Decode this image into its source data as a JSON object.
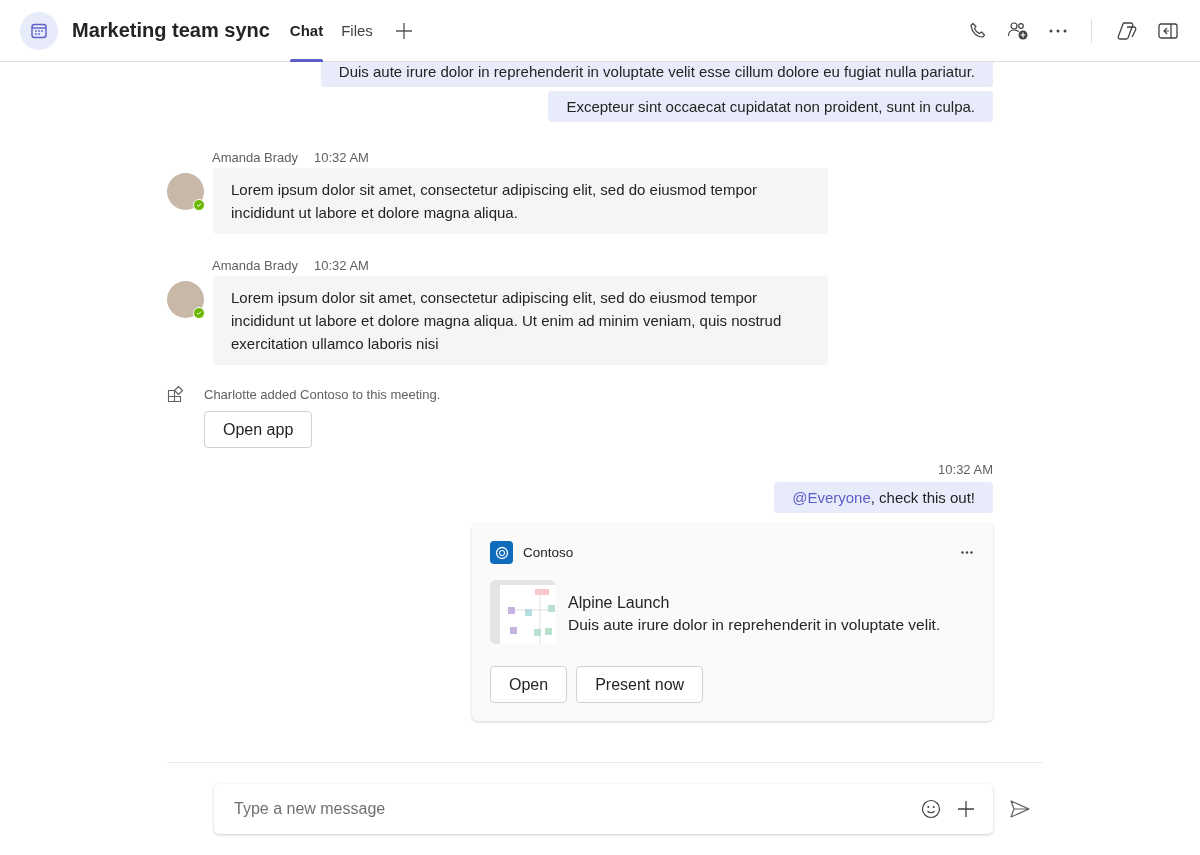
{
  "header": {
    "title": "Marketing team sync",
    "tabs": [
      {
        "label": "Chat",
        "selected": true
      },
      {
        "label": "Files",
        "selected": false
      }
    ]
  },
  "messages": [
    {
      "kind": "outgoing",
      "text": "Duis aute irure dolor in reprehenderit in voluptate velit esse cillum dolore eu fugiat nulla pariatur."
    },
    {
      "kind": "outgoing",
      "text": "Excepteur sint occaecat cupidatat non proident, sunt in culpa."
    },
    {
      "kind": "incoming",
      "sender": "Amanda Brady",
      "time": "10:32 AM",
      "online": true,
      "text": "Lorem ipsum dolor sit amet, consectetur adipiscing elit, sed do eiusmod tempor incididunt ut labore et dolore magna aliqua."
    },
    {
      "kind": "incoming",
      "sender": "Amanda Brady",
      "time": "10:32 AM",
      "online": true,
      "text": "Lorem ipsum dolor sit amet, consectetur adipiscing elit, sed do eiusmod tempor incididunt ut labore et dolore magna aliqua. Ut enim ad minim veniam, quis nostrud exercitation ullamco laboris nisi"
    },
    {
      "kind": "system",
      "text": "Charlotte added Contoso to this meeting.",
      "button": "Open app"
    },
    {
      "kind": "outgoing",
      "time": "10:32 AM",
      "mention": "@Everyone",
      "text": ", check this out!"
    },
    {
      "kind": "card",
      "app": "Contoso",
      "title": "Alpine Launch",
      "description": "Duis aute irure dolor in reprehenderit in voluptate velit.",
      "buttons": [
        "Open",
        "Present now"
      ]
    }
  ],
  "compose": {
    "placeholder": "Type a new message"
  }
}
